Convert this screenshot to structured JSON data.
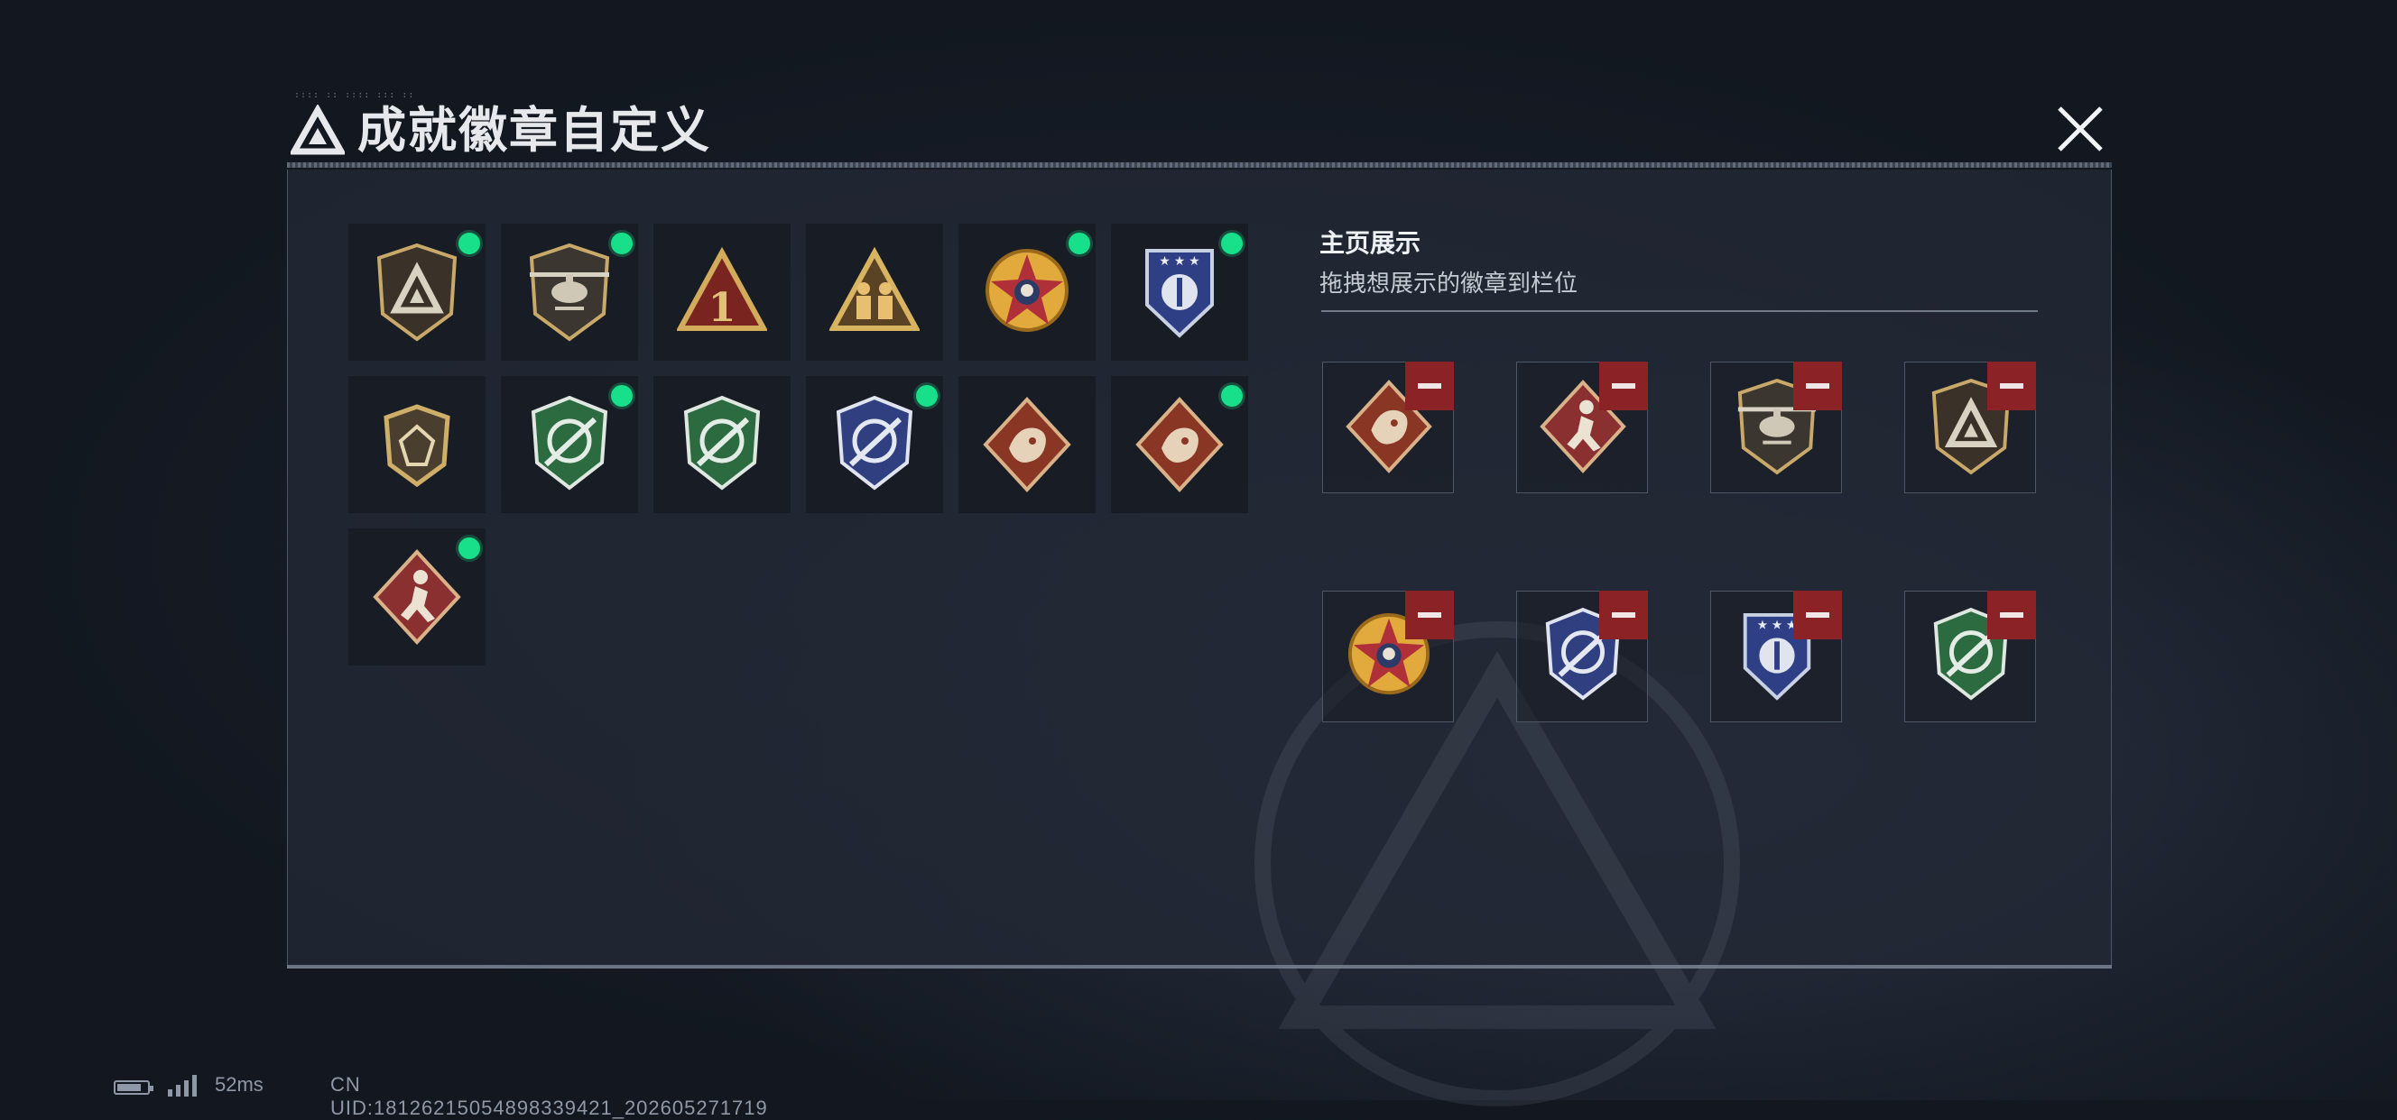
{
  "window": {
    "title": "成就徽章自定义",
    "close_label": "关闭"
  },
  "collection": {
    "badges": [
      {
        "name": "delta-shield",
        "equipped": true
      },
      {
        "name": "helicopter-shield",
        "equipped": true
      },
      {
        "name": "number-one-triangle",
        "equipped": false
      },
      {
        "name": "soldiers-triangle",
        "equipped": false
      },
      {
        "name": "star-skull-roundel",
        "equipped": true
      },
      {
        "name": "blue-star-emblem",
        "equipped": true
      },
      {
        "name": "crystal-shield",
        "equipped": false
      },
      {
        "name": "green-crosshair-rifle",
        "equipped": true
      },
      {
        "name": "green-crosshair-rifle",
        "equipped": false
      },
      {
        "name": "blue-crosshair-rifle",
        "equipped": true
      },
      {
        "name": "dragon-diamond",
        "equipped": false
      },
      {
        "name": "dragon-diamond",
        "equipped": true
      },
      {
        "name": "runner-diamond",
        "equipped": true
      }
    ]
  },
  "showcase": {
    "title": "主页展示",
    "subtitle": "拖拽想展示的徽章到栏位",
    "slots": [
      {
        "name": "dragon-diamond"
      },
      {
        "name": "runner-diamond"
      },
      {
        "name": "helicopter-shield"
      },
      {
        "name": "delta-shield"
      },
      {
        "name": "star-skull-roundel"
      },
      {
        "name": "blue-crosshair-rifle"
      },
      {
        "name": "blue-star-emblem"
      },
      {
        "name": "green-crosshair-rifle"
      }
    ]
  },
  "status_bar": {
    "ping": "52ms",
    "uid": "CN UID:18126215054898339421_202605271719"
  },
  "colors": {
    "equipped_dot": "#18e08a",
    "remove_button": "#8a2226",
    "panel_bg": "#222834"
  }
}
